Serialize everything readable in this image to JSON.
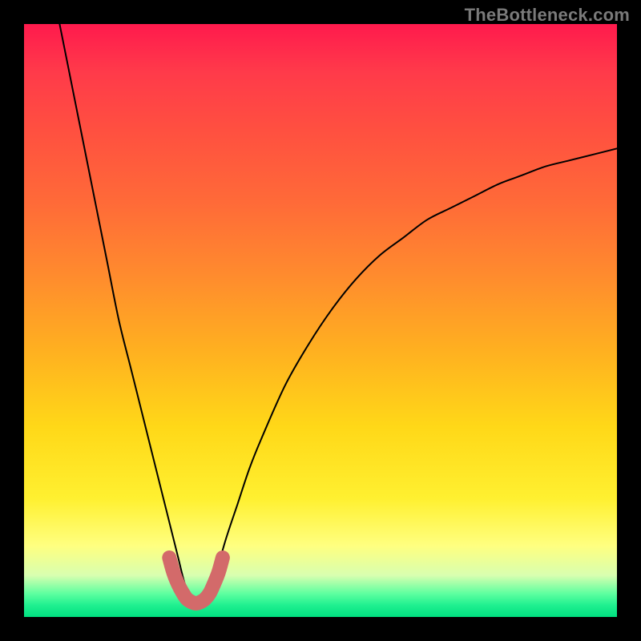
{
  "watermark": "TheBottleneck.com",
  "chart_data": {
    "type": "line",
    "title": "",
    "xlabel": "",
    "ylabel": "",
    "xlim": [
      0,
      100
    ],
    "ylim": [
      0,
      100
    ],
    "series": [
      {
        "name": "bottleneck-curve",
        "x": [
          6,
          8,
          10,
          12,
          14,
          16,
          18,
          20,
          22,
          24,
          26,
          27,
          28,
          29,
          30,
          31,
          32,
          34,
          36,
          38,
          40,
          44,
          48,
          52,
          56,
          60,
          64,
          68,
          72,
          76,
          80,
          84,
          88,
          92,
          96,
          100
        ],
        "values": [
          100,
          90,
          80,
          70,
          60,
          50,
          42,
          34,
          26,
          18,
          10,
          6,
          3,
          2,
          2,
          3,
          6,
          13,
          19,
          25,
          30,
          39,
          46,
          52,
          57,
          61,
          64,
          67,
          69,
          71,
          73,
          74.5,
          76,
          77,
          78,
          79
        ]
      },
      {
        "name": "bottom-marker",
        "x": [
          24.5,
          25.2,
          26,
          26.8,
          27.5,
          28.3,
          29,
          29.7,
          30.5,
          31.3,
          32,
          32.8,
          33.5
        ],
        "values": [
          10,
          7.5,
          5.5,
          4,
          3,
          2.5,
          2.3,
          2.5,
          3,
          4,
          5.5,
          7.5,
          10
        ]
      }
    ],
    "marker_color": "#d36a6a",
    "curve_color": "#000000"
  }
}
